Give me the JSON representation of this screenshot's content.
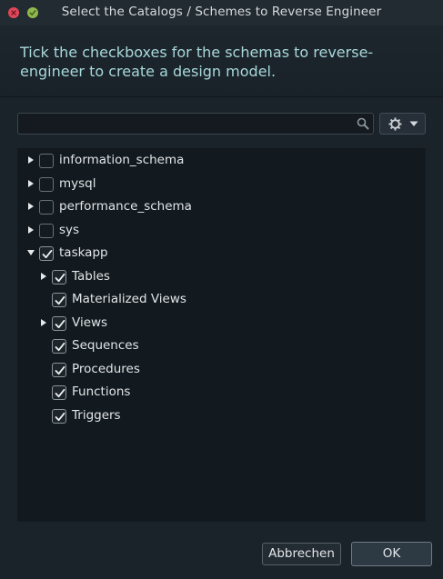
{
  "window": {
    "title": "Select the Catalogs / Schemes to Reverse Engineer",
    "close_color": "#e0475a",
    "zoom_color": "#8fb84c"
  },
  "instruction": "Tick the checkboxes for the schemas to reverse-engineer to create a design model.",
  "search": {
    "value": "",
    "placeholder": ""
  },
  "tree": {
    "items": [
      {
        "label": "information_schema",
        "checked": false,
        "expander": "collapsed",
        "level": 0
      },
      {
        "label": "mysql",
        "checked": false,
        "expander": "collapsed",
        "level": 0
      },
      {
        "label": "performance_schema",
        "checked": false,
        "expander": "collapsed",
        "level": 0
      },
      {
        "label": "sys",
        "checked": false,
        "expander": "collapsed",
        "level": 0
      },
      {
        "label": "taskapp",
        "checked": true,
        "expander": "expanded",
        "level": 0
      },
      {
        "label": "Tables",
        "checked": true,
        "expander": "collapsed",
        "level": 1
      },
      {
        "label": "Materialized Views",
        "checked": true,
        "expander": "none",
        "level": 1
      },
      {
        "label": "Views",
        "checked": true,
        "expander": "collapsed",
        "level": 1
      },
      {
        "label": "Sequences",
        "checked": true,
        "expander": "none",
        "level": 1
      },
      {
        "label": "Procedures",
        "checked": true,
        "expander": "none",
        "level": 1
      },
      {
        "label": "Functions",
        "checked": true,
        "expander": "none",
        "level": 1
      },
      {
        "label": "Triggers",
        "checked": true,
        "expander": "none",
        "level": 1
      }
    ]
  },
  "footer": {
    "cancel_label": "Abbrechen",
    "ok_label": "OK"
  }
}
